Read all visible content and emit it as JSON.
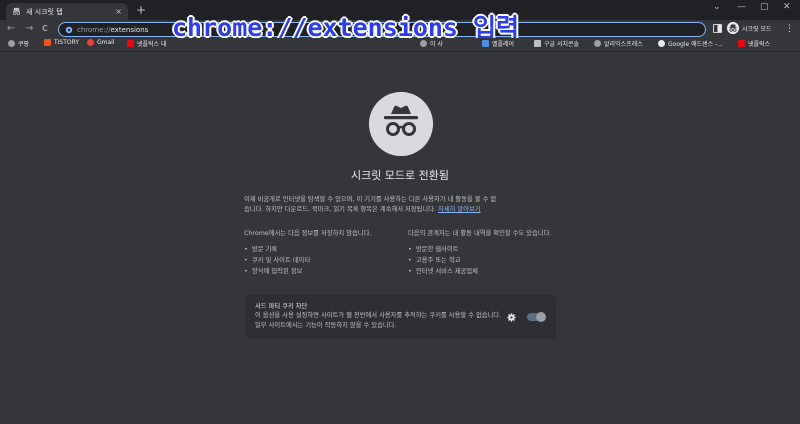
{
  "tab": {
    "title": "새 시크릿 탭",
    "close": "×"
  },
  "new_tab": "+",
  "window_controls": {
    "dropdown": "⌄",
    "minimize": "—",
    "maximize": "▢",
    "close": "✕"
  },
  "nav": {
    "back": "←",
    "forward": "→",
    "reload": "C"
  },
  "omnibox": {
    "scheme": "chrome://",
    "host": "extensions"
  },
  "profile": {
    "label": "시크릿 모드"
  },
  "menu_icon": "⋮",
  "overlay_caption": "chrome://extensions 입력",
  "bookmarks": [
    {
      "label": "쿠팡",
      "icon": "globe-icon",
      "color": "#9aa0a6"
    },
    {
      "label": "TISTORY",
      "icon": "tistory-icon",
      "color": "#eb531f"
    },
    {
      "label": "Gmail",
      "icon": "gmail-icon",
      "color": "#ea4335"
    },
    {
      "label": "넷플릭스 대",
      "icon": "netflix-icon",
      "color": "#e50914"
    },
    {
      "label": "이 사",
      "icon": "globe-icon",
      "color": "#9aa0a6"
    },
    {
      "label": "멜플레이",
      "icon": "play-icon",
      "color": "#4a90e2"
    },
    {
      "label": "구글 서치콘솔",
      "icon": "console-icon",
      "color": "#bdc1c6"
    },
    {
      "label": "알리익스프레스",
      "icon": "globe-icon",
      "color": "#9aa0a6"
    },
    {
      "label": "Google 애드센스 -...",
      "icon": "google-icon",
      "color": "#e8eaed"
    },
    {
      "label": "넷플릭스",
      "icon": "netflix-icon",
      "color": "#e50914"
    }
  ],
  "page": {
    "heading": "시크릿 모드로 전환됨",
    "intro_line1": "이제 비공개로 인터넷을 탐색할 수 있으며, 이 기기를 사용하는 다른 사용자가 내 활동을 볼 수 없",
    "intro_line2": "습니다. 하지만 다운로드, 북마크, 읽기 목록 항목은 계속해서 저장됩니다.",
    "learn_more": "자세히 알아보기",
    "left_col": {
      "title": "Chrome에서는 다음 정보를 저장하지 않습니다.",
      "items": [
        "방문 기록",
        "쿠키 및 사이트 데이터",
        "양식에 입력된 정보"
      ]
    },
    "right_col": {
      "title": "다음의 관계자는 내 활동 내역을 확인할 수도 있습니다.",
      "items": [
        "방문한 웹사이트",
        "고용주 또는 학교",
        "인터넷 서비스 제공업체"
      ]
    },
    "cookie": {
      "title": "서드 파티 쿠키 차단",
      "desc": "이 옵션을 사용 설정하면 사이트가 웹 전반에서 사용자를 추적하는 쿠키를 사용할 수 없습니다. 일부 사이트에서는 기능이 작동하지 않을 수 있습니다."
    }
  },
  "colors": {
    "background": "#35363a",
    "tabstrip": "#202124",
    "accent": "#8ab4f8",
    "overlay_text": "#2d3dea"
  }
}
